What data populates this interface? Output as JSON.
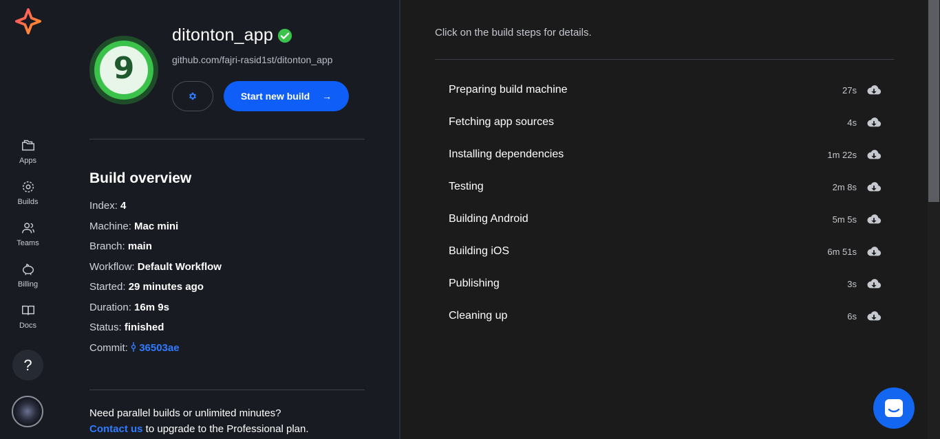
{
  "sidebar": {
    "items": [
      {
        "label": "Apps",
        "icon": "folder-icon"
      },
      {
        "label": "Builds",
        "icon": "builds-icon"
      },
      {
        "label": "Teams",
        "icon": "teams-icon"
      },
      {
        "label": "Billing",
        "icon": "piggy-bank-icon"
      },
      {
        "label": "Docs",
        "icon": "book-icon"
      }
    ],
    "help_label": "?"
  },
  "app": {
    "name": "ditonton_app",
    "logo_glyph": "9",
    "url": "github.com/fajri-rasid1st/ditonton_app",
    "start_label": "Start new build",
    "start_arrow": "→"
  },
  "overview": {
    "title": "Build overview",
    "rows": [
      {
        "label": "Index:",
        "value": "4"
      },
      {
        "label": "Machine:",
        "value": "Mac mini"
      },
      {
        "label": "Branch:",
        "value": "main"
      },
      {
        "label": "Workflow:",
        "value": "Default Workflow"
      },
      {
        "label": "Started:",
        "value": "29 minutes ago"
      },
      {
        "label": "Duration:",
        "value": "16m 9s"
      },
      {
        "label": "Status:",
        "value": "finished"
      },
      {
        "label": "Commit:",
        "value": "36503ae"
      }
    ]
  },
  "upgrade": {
    "line1": "Need parallel builds or unlimited minutes?",
    "link": "Contact us",
    "line2": " to upgrade to the Professional plan."
  },
  "steps": {
    "hint": "Click on the build steps for details.",
    "items": [
      {
        "name": "Preparing build machine",
        "time": "27s"
      },
      {
        "name": "Fetching app sources",
        "time": "4s"
      },
      {
        "name": "Installing dependencies",
        "time": "1m 22s"
      },
      {
        "name": "Testing",
        "time": "2m 8s"
      },
      {
        "name": "Building Android",
        "time": "5m 5s"
      },
      {
        "name": "Building iOS",
        "time": "6m 51s"
      },
      {
        "name": "Publishing",
        "time": "3s"
      },
      {
        "name": "Cleaning up",
        "time": "6s"
      }
    ]
  },
  "colors": {
    "accent": "#0f5ef7",
    "link": "#2f7bff",
    "verified": "#3ac24a",
    "background": "#191b23"
  }
}
